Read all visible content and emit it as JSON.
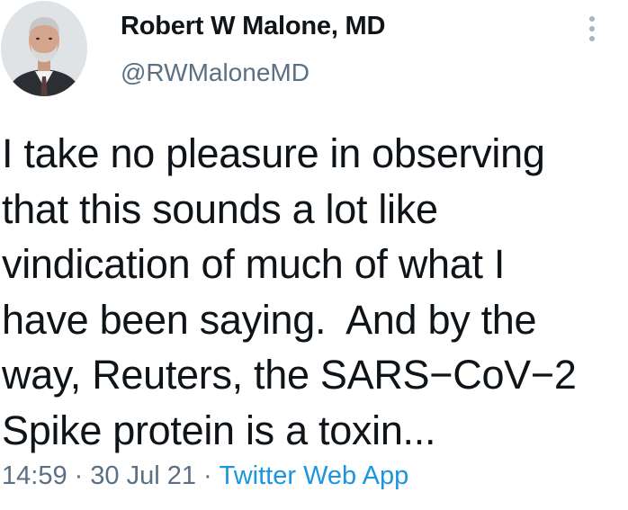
{
  "tweet": {
    "author": {
      "display_name": "Robert W Malone, MD",
      "handle": "@RWMaloneMD",
      "avatar_icon": "profile-photo"
    },
    "more_icon": "more-vertical-icon",
    "text": "I take no pleasure in observing\nthat this sounds a lot like\nvindication of much of what I\nhave been saying.  And by the\nway, Reuters, the SARS−CoV−2\nSpike protein is a toxin...",
    "time": "14:59",
    "separator": "·",
    "date": "30 Jul 21",
    "source": "Twitter Web App",
    "colors": {
      "text": "#0f1419",
      "secondary": "#5b7083",
      "link": "#1b95e0",
      "background": "#ffffff"
    }
  }
}
